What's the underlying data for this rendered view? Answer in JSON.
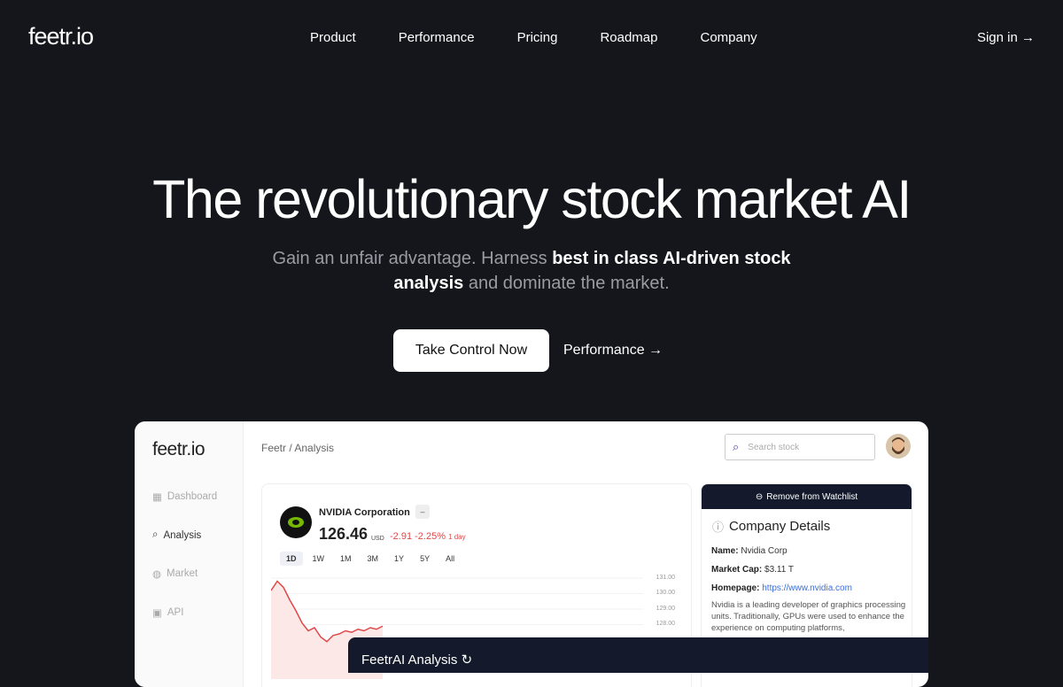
{
  "nav": {
    "logo": "feetr.io",
    "links": [
      "Product",
      "Performance",
      "Pricing",
      "Roadmap",
      "Company"
    ],
    "signin": "Sign in →"
  },
  "hero": {
    "title": "The revolutionary stock market AI",
    "sub_1": "Gain an unfair advantage. Harness ",
    "sub_bold_1": "best in class AI-driven stock analysis",
    "sub_2": " and dominate the market.",
    "cta": "Take Control Now",
    "secondary": "Performance →"
  },
  "app": {
    "logo": "feetr.io",
    "sidebar": [
      {
        "label": "Dashboard",
        "icon": "grid-icon"
      },
      {
        "label": "Analysis",
        "icon": "search-icon",
        "active": true
      },
      {
        "label": "Market",
        "icon": "globe-icon"
      },
      {
        "label": "API",
        "icon": "terminal-icon"
      }
    ],
    "breadcrumb": "Feetr / Analysis",
    "search_placeholder": "Search stock",
    "stock": {
      "name": "NVIDIA Corporation",
      "tag": "–",
      "price": "126.46",
      "currency": "USD",
      "change": "-2.91",
      "change_pct": "-2.25%",
      "period": "1 day",
      "ranges": [
        "1D",
        "1W",
        "1M",
        "3M",
        "1Y",
        "5Y",
        "All"
      ],
      "selected_range": "1D",
      "y_ticks": [
        "131.00",
        "130.00",
        "129.00",
        "128.00"
      ],
      "line_color": "#e04848",
      "series": [
        130.2,
        130.8,
        130.4,
        129.6,
        128.9,
        128.1,
        127.6,
        127.8,
        127.2,
        126.9,
        127.3,
        127.4,
        127.6,
        127.5,
        127.7,
        127.6,
        127.8,
        127.7,
        127.9
      ]
    },
    "watchlist_button": "Remove from Watchlist",
    "details": {
      "title": "Company Details",
      "name_label": "Name:",
      "name": "Nvidia Corp",
      "cap_label": "Market Cap:",
      "cap": "$3.11 T",
      "home_label": "Homepage:",
      "home": "https://www.nvidia.com",
      "description": "Nvidia is a leading developer of graphics processing units. Traditionally, GPUs were used to enhance the experience on computing platforms,"
    },
    "ai_title": "FeetrAI Analysis"
  }
}
